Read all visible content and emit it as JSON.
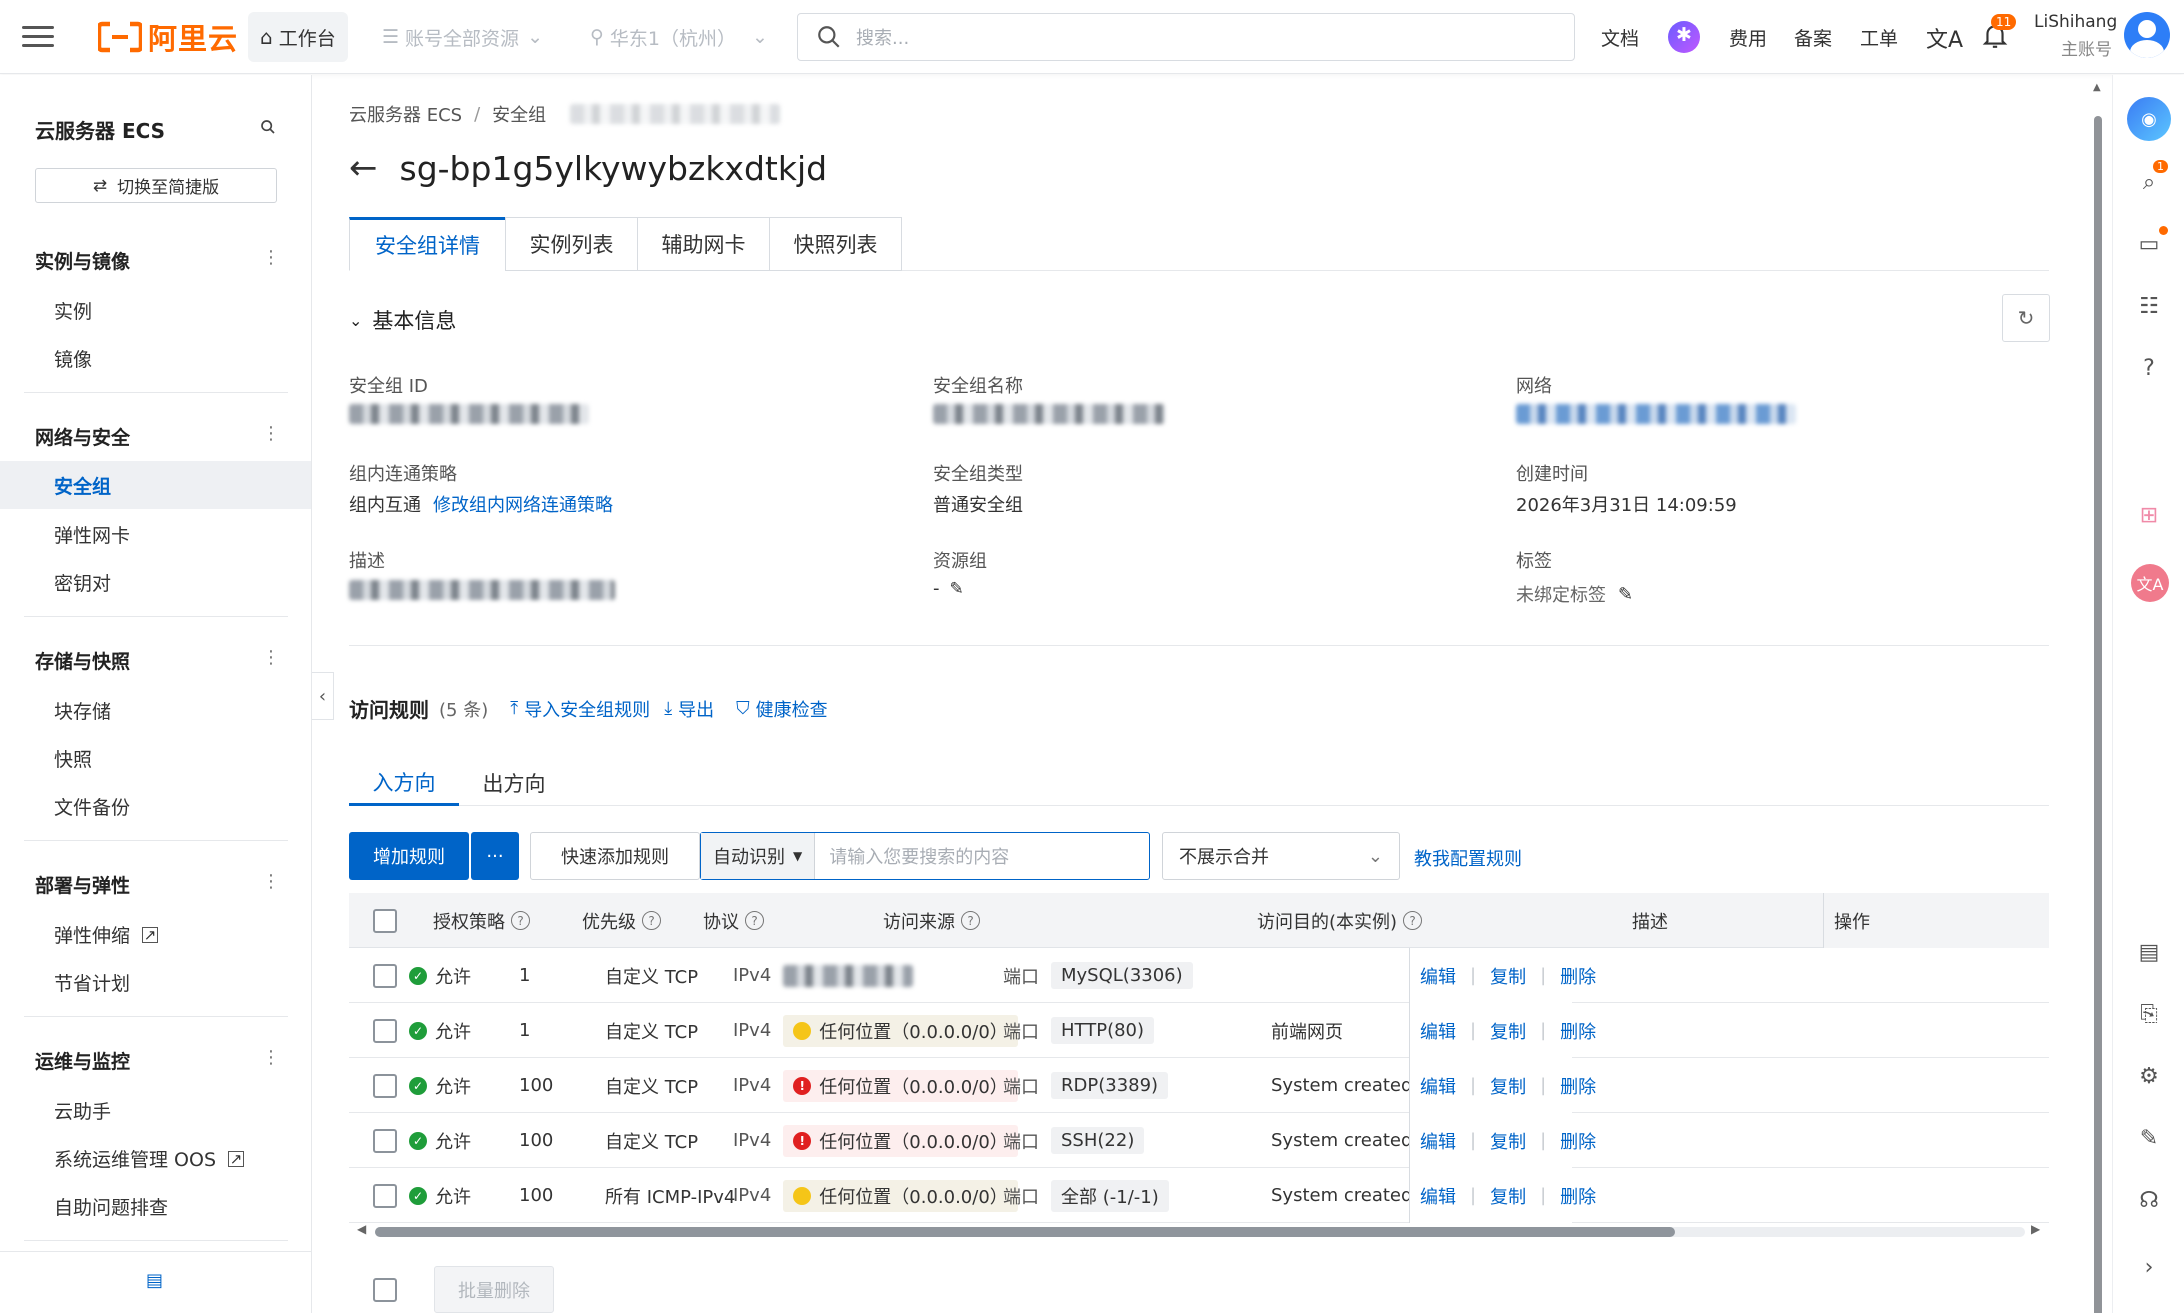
{
  "topbar": {
    "logo": "阿里云",
    "workbench": "工作台",
    "account_scope": "账号全部资源",
    "region": "华东1（杭州）",
    "search_placeholder": "搜索...",
    "links": [
      "文档",
      "费用",
      "备案",
      "工单"
    ],
    "notification_count": "11",
    "user_name": "LiShihang",
    "user_role": "主账号"
  },
  "sidebar": {
    "title": "云服务器 ECS",
    "switch_label": "切换至简捷版",
    "groups": [
      {
        "label": "实例与镜像",
        "items": [
          "实例",
          "镜像"
        ]
      },
      {
        "label": "网络与安全",
        "items": [
          "安全组",
          "弹性网卡",
          "密钥对"
        ]
      },
      {
        "label": "存储与快照",
        "items": [
          "块存储",
          "快照",
          "文件备份"
        ]
      },
      {
        "label": "部署与弹性",
        "items": [
          "弹性伸缩",
          "节省计划"
        ]
      },
      {
        "label": "运维与监控",
        "items": [
          "云助手",
          "系统运维管理 OOS",
          "自助问题排查"
        ]
      }
    ],
    "active_item": "安全组"
  },
  "breadcrumb": {
    "root": "云服务器 ECS",
    "sep": "/",
    "current": "安全组"
  },
  "page_title": "sg-bp1g5ylkywybzkxdtkjd",
  "tabs": [
    "安全组详情",
    "实例列表",
    "辅助网卡",
    "快照列表"
  ],
  "basic": {
    "section_title": "基本信息",
    "fields": {
      "sg_id_label": "安全组 ID",
      "sg_name_label": "安全组名称",
      "network_label": "网络",
      "policy_label": "组内连通策略",
      "policy_value": "组内互通",
      "policy_link": "修改组内网络连通策略",
      "type_label": "安全组类型",
      "type_value": "普通安全组",
      "created_label": "创建时间",
      "created_value": "2026年3月31日 14:09:59",
      "desc_label": "描述",
      "rg_label": "资源组",
      "rg_value": "-",
      "tags_label": "标签",
      "tags_value": "未绑定标签"
    }
  },
  "rules": {
    "title": "访问规则",
    "count": "(5 条)",
    "import_label": "导入安全组规则",
    "export_label": "导出",
    "health_label": "健康检查",
    "dir_tabs": [
      "入方向",
      "出方向"
    ],
    "add_label": "增加规则",
    "more_label": "···",
    "quick_add_label": "快速添加规则",
    "auto_detect_label": "自动识别",
    "search_placeholder": "请输入您要搜索的内容",
    "merge_select": "不展示合并",
    "teach_link": "教我配置规则",
    "columns": [
      "授权策略",
      "优先级",
      "协议",
      "访问来源",
      "访问目的(本实例)",
      "描述",
      "操作"
    ],
    "rows": [
      {
        "policy": "允许",
        "priority": "1",
        "protocol": "自定义 TCP",
        "ipver": "IPv4",
        "source": "",
        "port_label": "端口",
        "dest": "MySQL(3306)",
        "desc": ""
      },
      {
        "policy": "允许",
        "priority": "1",
        "protocol": "自定义 TCP",
        "ipver": "IPv4",
        "source": "任何位置（0.0.0.0/0）",
        "port_label": "端口",
        "dest": "HTTP(80)",
        "desc": "前端网页"
      },
      {
        "policy": "允许",
        "priority": "100",
        "protocol": "自定义 TCP",
        "ipver": "IPv4",
        "source": "任何位置（0.0.0.0/0）",
        "port_label": "端口",
        "dest": "RDP(3389)",
        "desc": "System created rule."
      },
      {
        "policy": "允许",
        "priority": "100",
        "protocol": "自定义 TCP",
        "ipver": "IPv4",
        "source": "任何位置（0.0.0.0/0）",
        "port_label": "端口",
        "dest": "SSH(22)",
        "desc": "System created rule."
      },
      {
        "policy": "允许",
        "priority": "100",
        "protocol": "所有 ICMP-IPv4",
        "ipver": "IPv4",
        "source": "任何位置（0.0.0.0/0）",
        "port_label": "端口",
        "dest": "全部 (-1/-1)",
        "desc": "System created rule."
      }
    ],
    "ops": [
      "编辑",
      "复制",
      "删除"
    ],
    "batch_delete": "批量删除"
  },
  "colors": {
    "accent": "#0064c8",
    "brand": "#ff6a00",
    "success": "#1f9d3a",
    "warning": "#f5c518",
    "danger": "#e02020"
  }
}
